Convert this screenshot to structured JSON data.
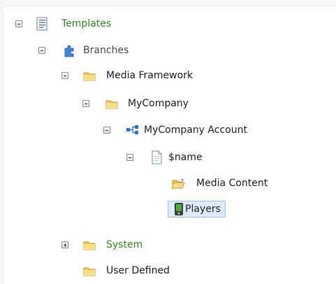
{
  "tree": {
    "templates": {
      "label": "Templates",
      "toggle": "expanded",
      "icon": "template-document-icon"
    },
    "branches": {
      "label": "Branches",
      "toggle": "expanded",
      "icon": "branches-puzzle-icon"
    },
    "media_framework": {
      "label": "Media Framework",
      "toggle": "expanded",
      "icon": "folder-icon"
    },
    "mycompany": {
      "label": "MyCompany",
      "toggle": "expanded",
      "icon": "folder-icon"
    },
    "mycompany_account": {
      "label": "MyCompany Account",
      "toggle": "expanded",
      "icon": "hierarchy-icon"
    },
    "name": {
      "label": "$name",
      "toggle": "expanded",
      "icon": "document-icon"
    },
    "media_content": {
      "label": "Media Content",
      "icon": "open-folder-icon"
    },
    "players": {
      "label": "Players",
      "icon": "player-icon",
      "selected": true
    },
    "system": {
      "label": "System",
      "toggle": "collapsed",
      "icon": "folder-icon"
    },
    "user_defined": {
      "label": "User Defined",
      "icon": "folder-icon"
    }
  },
  "colors": {
    "green_label": "#2f8a1f",
    "selection_bg": "#dcebfb",
    "selection_border": "#9cc3ea"
  }
}
